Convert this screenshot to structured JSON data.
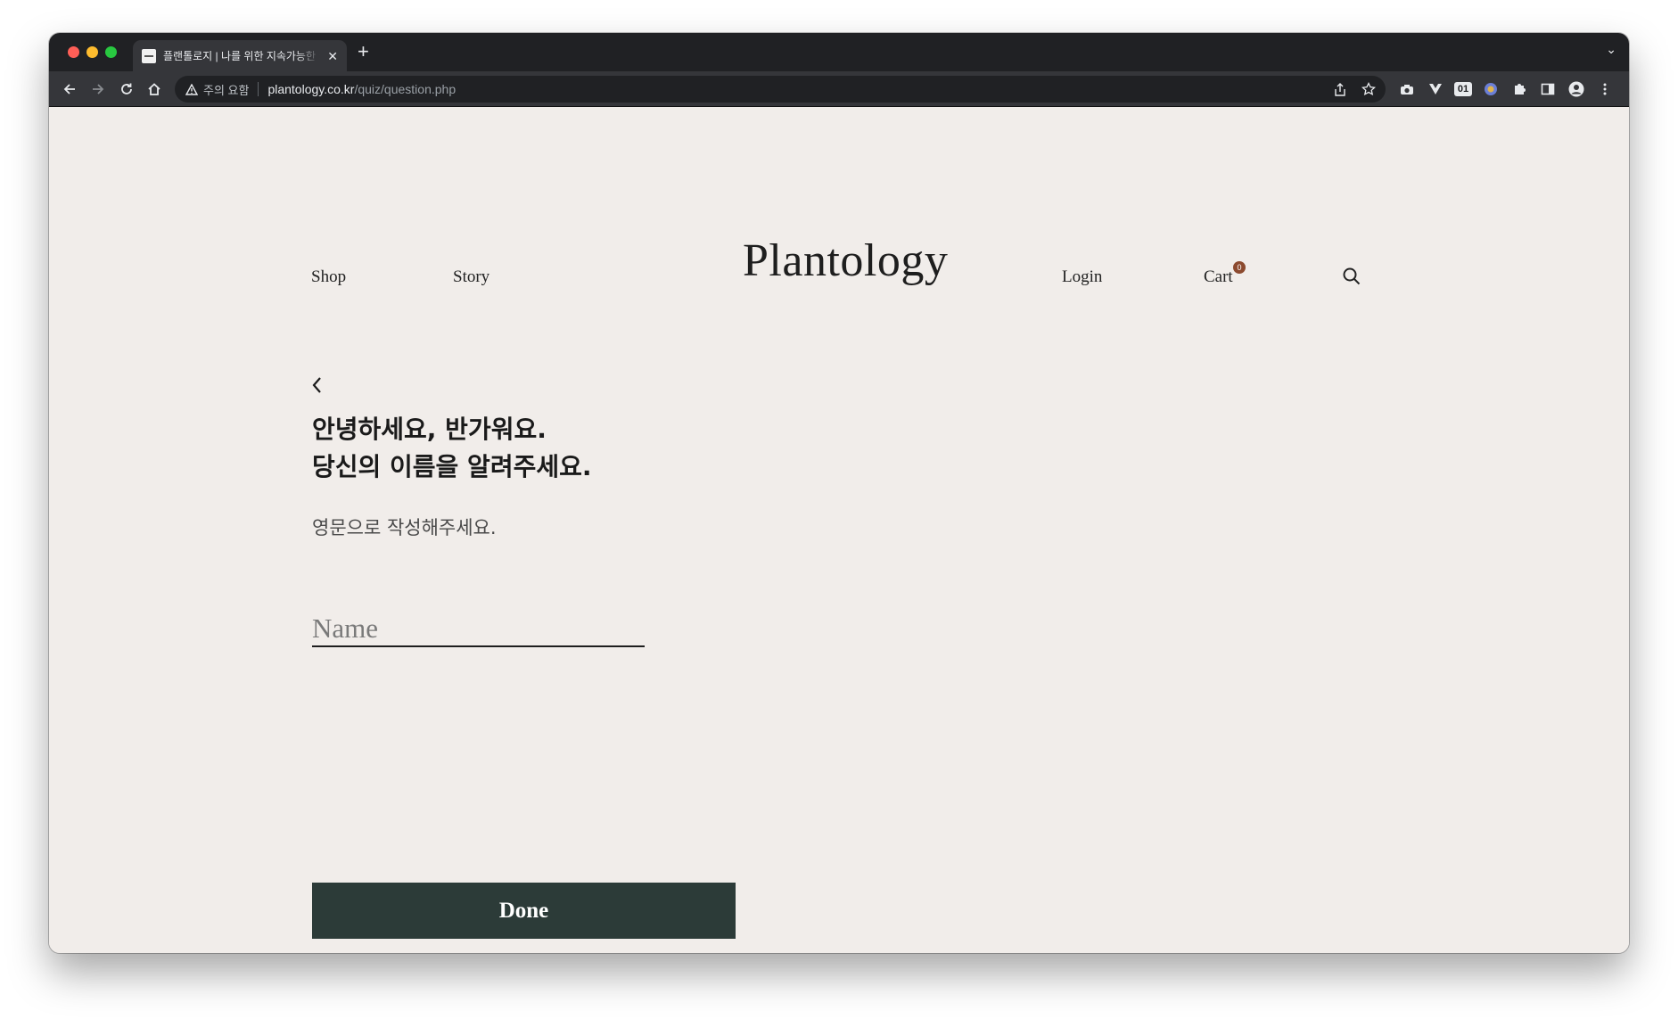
{
  "browser": {
    "tab_title": "플랜톨로지 | 나를 위한 지속가능한 키",
    "security_label": "주의 요함",
    "url_host": "plantology.co.kr",
    "url_path": "/quiz/question.php",
    "extension_badge": "01"
  },
  "site": {
    "logo": "Plantology",
    "nav_left": [
      "Shop",
      "Story"
    ],
    "nav_right": [
      "Login",
      "Cart"
    ],
    "cart_count": "0"
  },
  "quiz": {
    "title_line1": "안녕하세요, 반가워요.",
    "title_line2": "당신의 이름을 알려주세요.",
    "subtitle": "영문으로 작성해주세요.",
    "name_placeholder": "Name",
    "submit_label": "Done"
  },
  "colors": {
    "page_background": "#f1edea",
    "button_background": "#2c3b38",
    "cart_badge": "#8c4a2f"
  }
}
